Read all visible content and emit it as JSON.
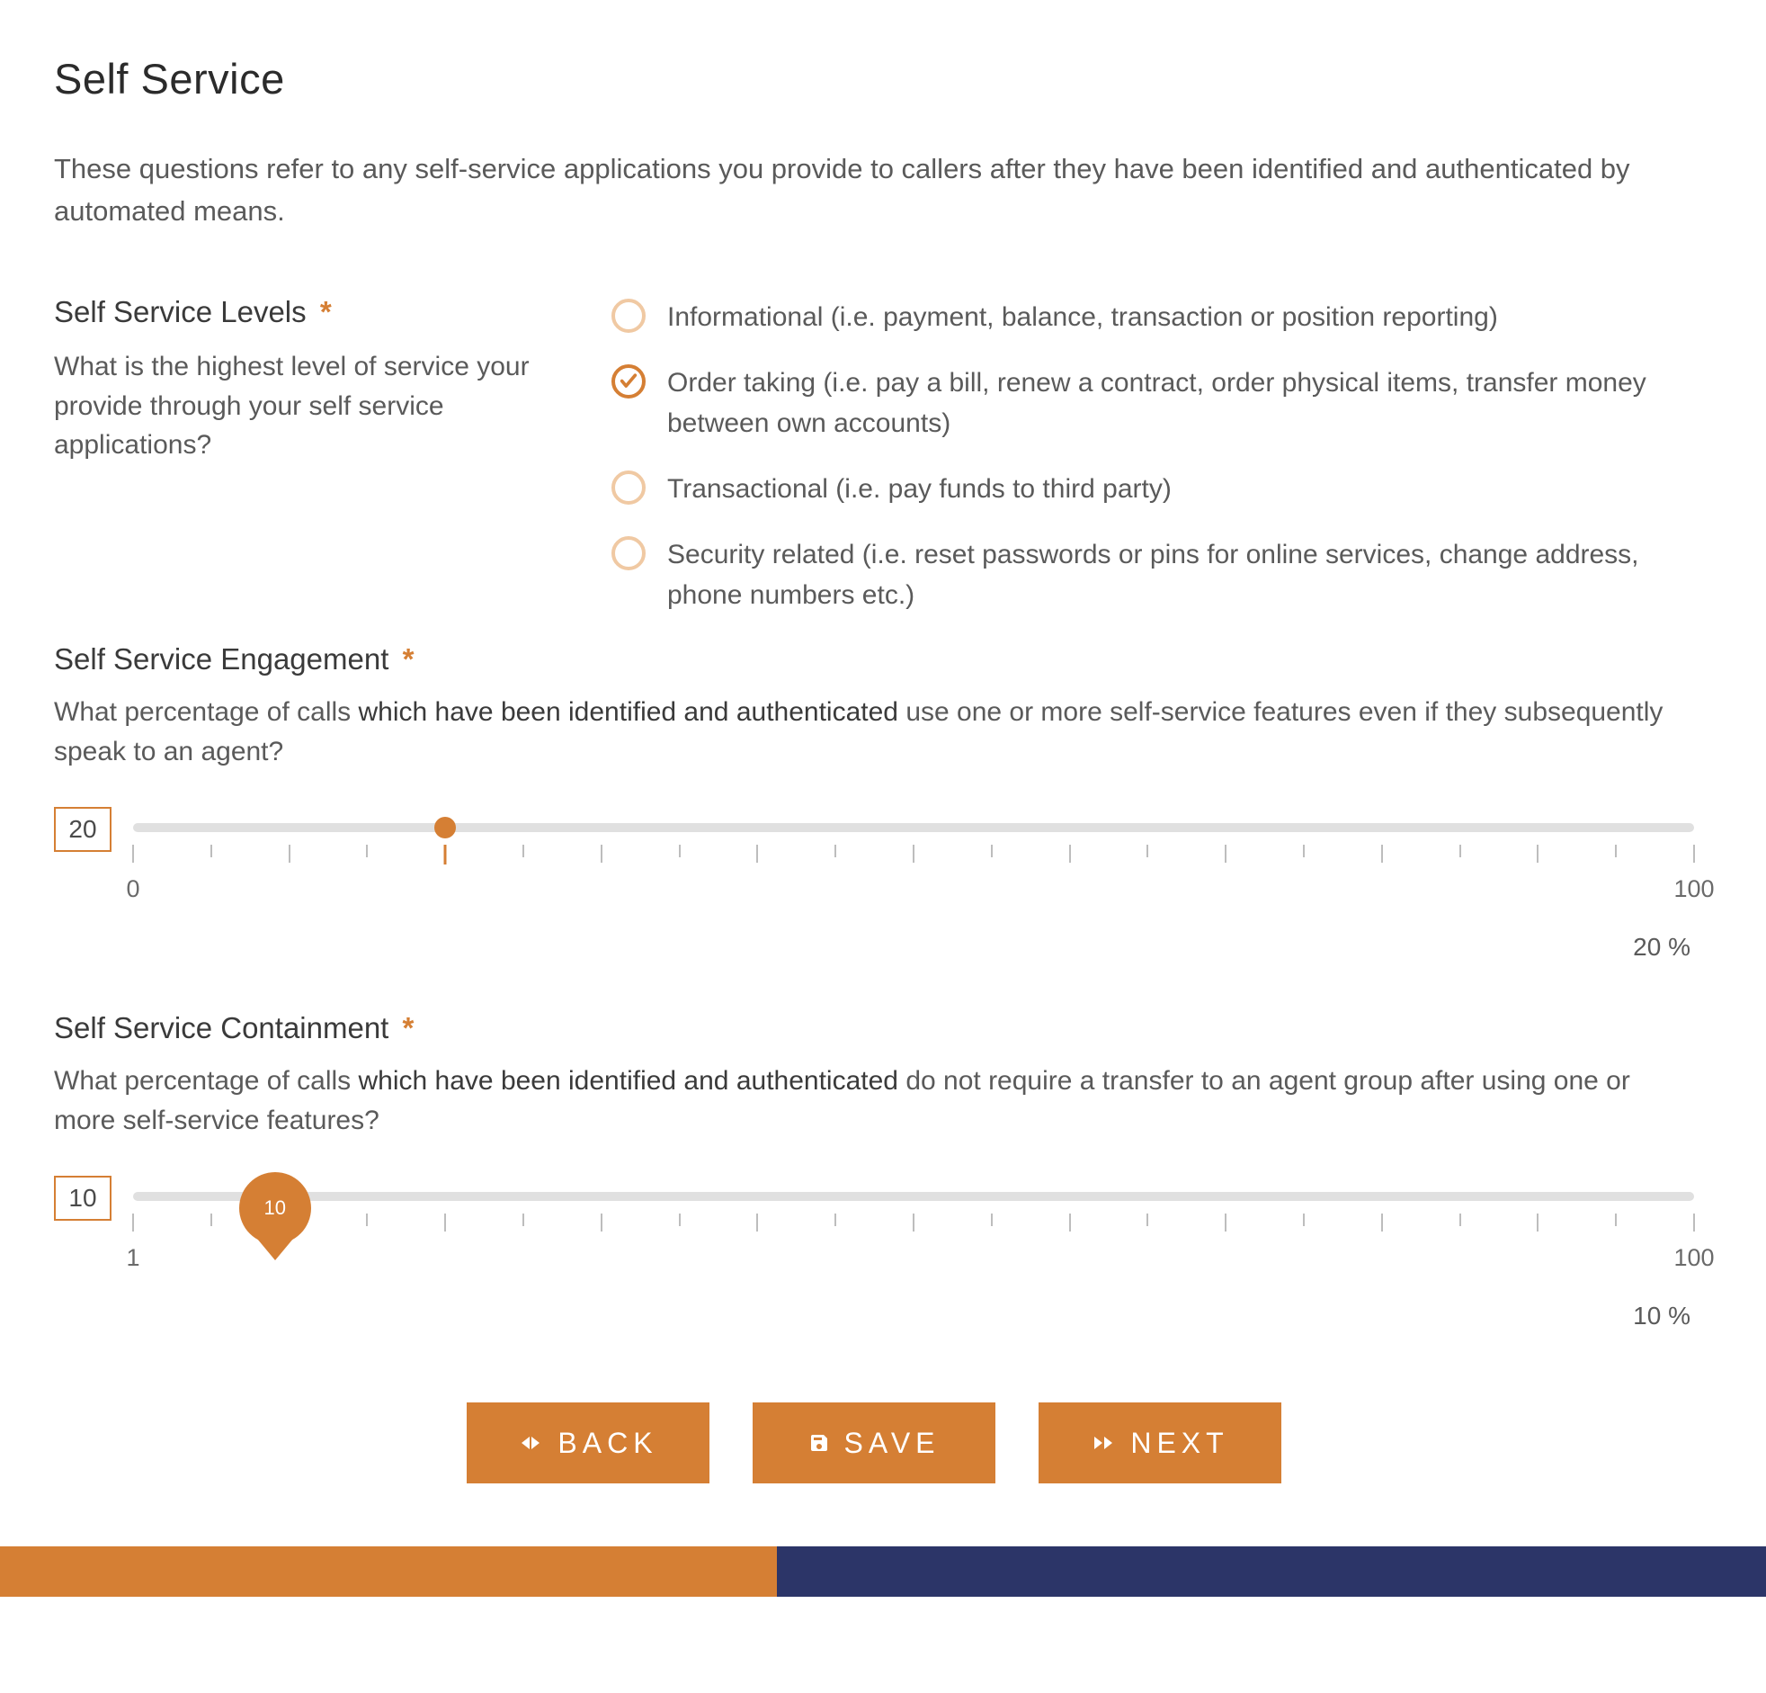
{
  "page": {
    "title": "Self Service",
    "intro": "These questions refer to any self-service applications you provide to callers after they have been identified and authenticated by automated means."
  },
  "levels": {
    "label": "Self Service Levels",
    "sub": "What is the highest level of service your provide through your self service applications?",
    "options": [
      {
        "label": "Informational (i.e. payment, balance, transaction or position reporting)",
        "checked": false
      },
      {
        "label": "Order taking (i.e. pay a bill, renew a contract, order physical items, transfer money between own accounts)",
        "checked": true
      },
      {
        "label": "Transactional (i.e. pay funds to third party)",
        "checked": false
      },
      {
        "label": "Security related (i.e. reset passwords or pins for online services, change address, phone numbers etc.)",
        "checked": false
      }
    ]
  },
  "engagement": {
    "label": "Self Service Engagement",
    "sub_pre": "What percentage of calls ",
    "sub_bold": "which have been identified and authenticated",
    "sub_post": " use one or more self-service features even if they subsequently speak to an agent?",
    "value": "20",
    "min": "0",
    "max": "100",
    "pct_label": "20 %"
  },
  "containment": {
    "label": "Self Service Containment",
    "sub_pre": "What percentage of calls ",
    "sub_bold": "which have been identified and authenticated",
    "sub_post": " do not require a transfer to an agent group after using one or more self-service features?",
    "value": "10",
    "tooltip": "10",
    "min": "1",
    "max": "100",
    "pct_label": "10 %"
  },
  "buttons": {
    "back": "BACK",
    "save": "SAVE",
    "next": "NEXT"
  },
  "required_star": "*"
}
